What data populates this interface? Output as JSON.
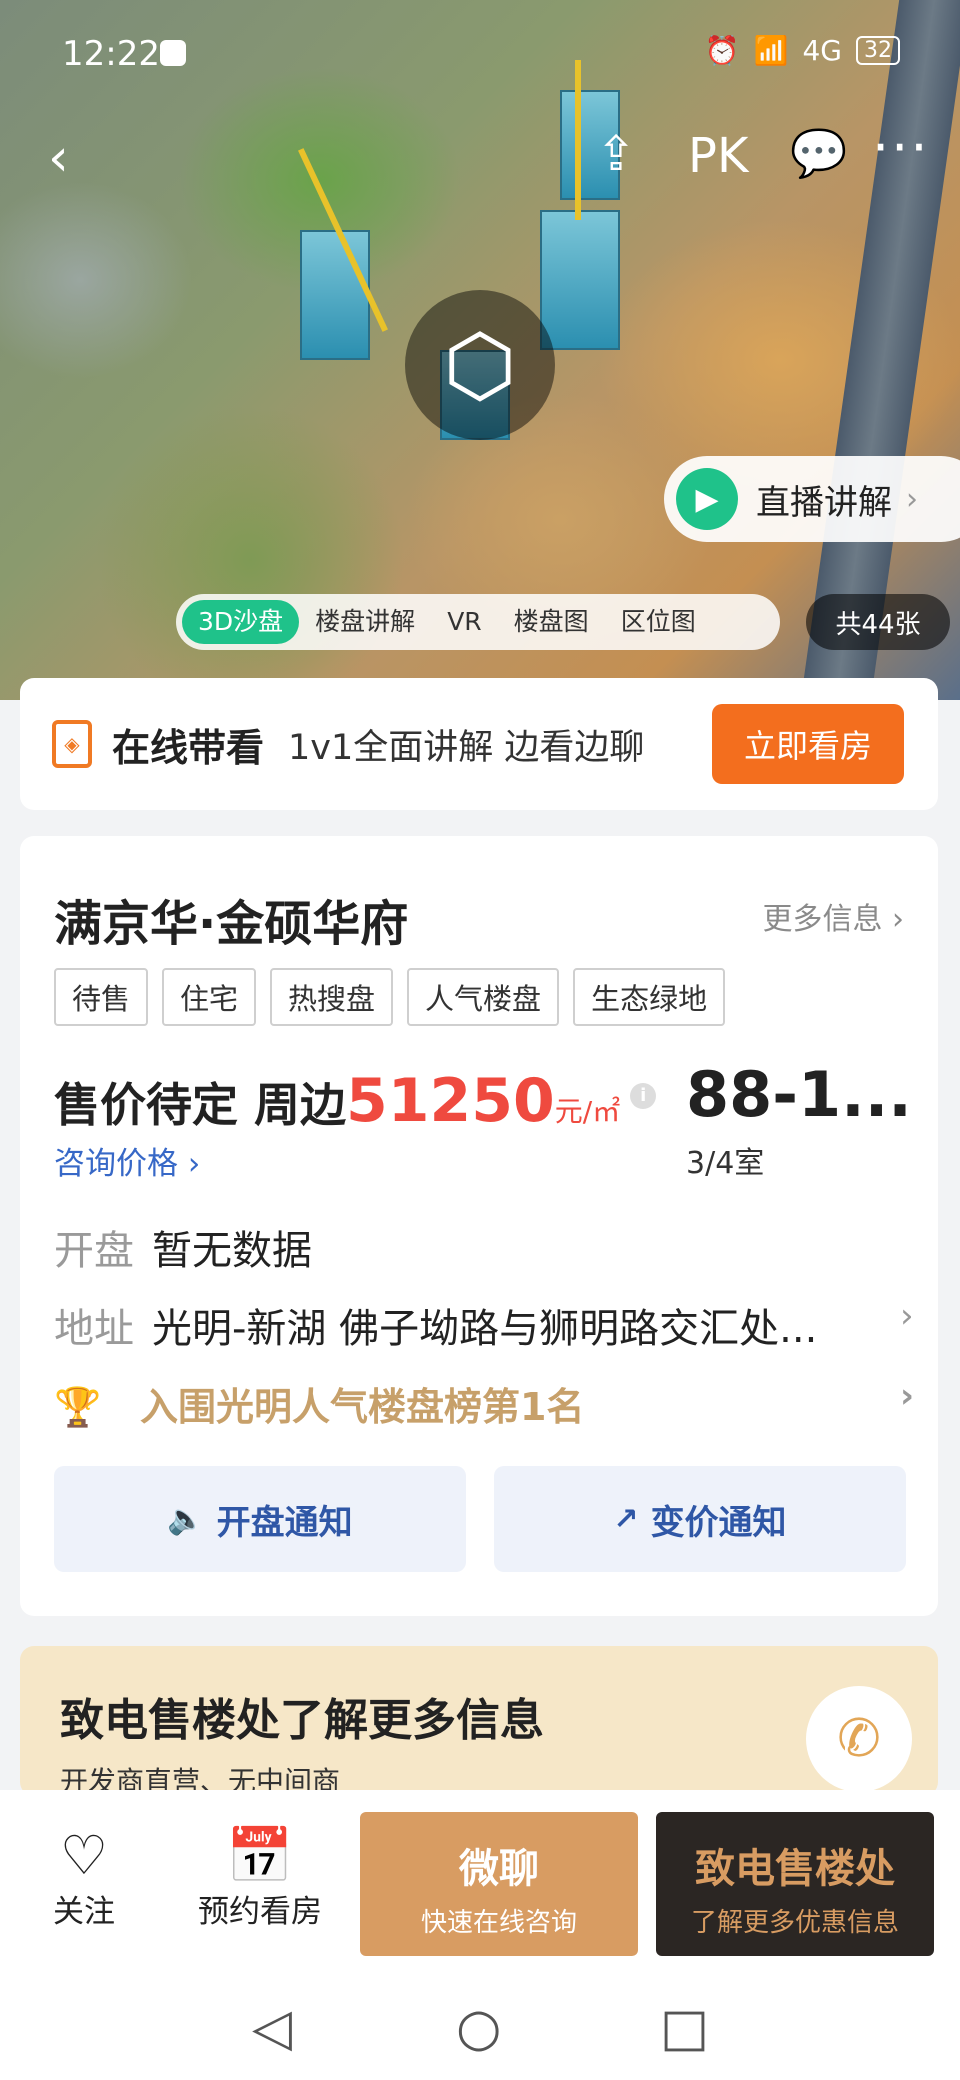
{
  "status_bar": {
    "time": "12:22",
    "network": "4G",
    "battery": "32"
  },
  "top_nav": {
    "pk_label": "PK"
  },
  "live": {
    "label": "直播讲解"
  },
  "media_tabs": [
    "3D沙盘",
    "楼盘讲解",
    "VR",
    "楼盘图",
    "区位图"
  ],
  "photo_count": "共44张",
  "online_view": {
    "title": "在线带看",
    "desc": "1v1全面讲解 边看边聊",
    "button": "立即看房"
  },
  "property": {
    "name": "满京华·金硕华府",
    "more_info": "更多信息",
    "tags": [
      "待售",
      "住宅",
      "热搜盘",
      "人气楼盘",
      "生态绿地"
    ],
    "price_prefix": "售价待定 周边",
    "price_value": "51250",
    "price_unit": "元/㎡",
    "consult_price": "咨询价格",
    "area": "88-1...",
    "rooms": "3/4室",
    "opening_key": "开盘",
    "opening_value": "暂无数据",
    "address_key": "地址",
    "address_value": "光明-新湖 佛子坳路与狮明路交汇处...",
    "ranking": "入围光明人气楼盘榜第1名",
    "notify_open": "开盘通知",
    "notify_price": "变价通知"
  },
  "sales_office": {
    "title": "致电售楼处了解更多信息",
    "subtitle": "开发商直营、无中间商"
  },
  "bottom_bar": {
    "follow": "关注",
    "book": "预约看房",
    "wechat_title": "微聊",
    "wechat_sub": "快速在线咨询",
    "call_title": "致电售楼处",
    "call_sub": "了解更多优惠信息"
  },
  "colors": {
    "accent_green": "#1fc28a",
    "accent_orange": "#f36e1e",
    "price_red": "#ef4a3f",
    "link_blue": "#3768c7",
    "gold": "#d89c62"
  }
}
